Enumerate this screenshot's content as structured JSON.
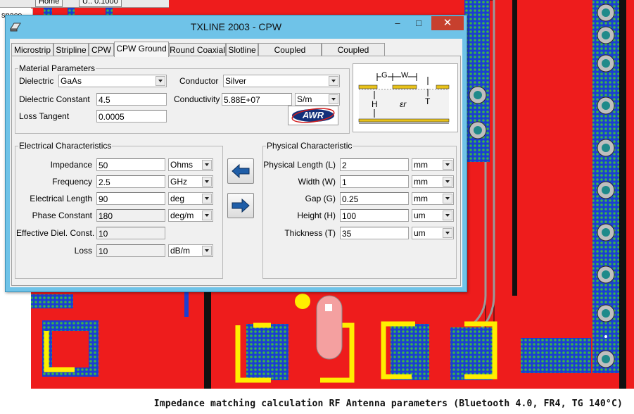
{
  "background": {
    "toolbar_buttons": [
      "Home",
      "U.. 0.1000"
    ],
    "left_label": "space",
    "caption": "Impedance matching calculation RF Antenna parameters (Bluetooth 4.0, FR4, TG 140°C)",
    "colors": {
      "board_red": "#ee1c1c",
      "via_teal": "#1f8a8a",
      "pad_yellow": "#ffee00",
      "trace_black": "#101010",
      "dot_green": "#2a9a4a"
    }
  },
  "window": {
    "title": "TXLINE 2003 - CPW",
    "controls": {
      "minimize": "–",
      "maximize": "□",
      "close": "✕"
    }
  },
  "tabs": [
    {
      "label": "Microstrip",
      "active": false
    },
    {
      "label": "Stripline",
      "active": false
    },
    {
      "label": "CPW",
      "active": false
    },
    {
      "label": "CPW Ground",
      "active": true
    },
    {
      "label": "Round Coaxial",
      "active": false
    },
    {
      "label": "Slotline",
      "active": false
    },
    {
      "label": "Coupled MSLine",
      "active": false
    },
    {
      "label": "Coupled Stripline",
      "active": false
    }
  ],
  "material": {
    "legend": "Material Parameters",
    "dielectric_label": "Dielectric",
    "dielectric_value": "GaAs",
    "conductor_label": "Conductor",
    "conductor_value": "Silver",
    "dielectric_constant_label": "Dielectric Constant",
    "dielectric_constant_value": "4.5",
    "conductivity_label": "Conductivity",
    "conductivity_value": "5.88E+07",
    "conductivity_unit": "S/m",
    "loss_tangent_label": "Loss Tangent",
    "loss_tangent_value": "0.0005",
    "awr_logo": "AWR"
  },
  "diagram": {
    "g_label": "G",
    "w_label": "W",
    "h_label": "H",
    "t_label": "T",
    "er_label": "εr"
  },
  "electrical": {
    "legend": "Electrical Characteristics",
    "rows": [
      {
        "label": "Impedance",
        "value": "50",
        "unit": "Ohms",
        "readonly": false
      },
      {
        "label": "Frequency",
        "value": "2.5",
        "unit": "GHz",
        "readonly": false
      },
      {
        "label": "Electrical Length",
        "value": "90",
        "unit": "deg",
        "readonly": false
      },
      {
        "label": "Phase Constant",
        "value": "180",
        "unit": "deg/m",
        "readonly": true
      },
      {
        "label": "Effective Diel. Const.",
        "value": "10",
        "unit": "",
        "readonly": true
      },
      {
        "label": "Loss",
        "value": "10",
        "unit": "dB/m",
        "readonly": true
      }
    ]
  },
  "physical": {
    "legend": "Physical Characteristic",
    "rows": [
      {
        "label": "Physical Length (L)",
        "value": "2",
        "unit": "mm"
      },
      {
        "label": "Width (W)",
        "value": "1",
        "unit": "mm"
      },
      {
        "label": "Gap (G)",
        "value": "0.25",
        "unit": "mm"
      },
      {
        "label": "Height (H)",
        "value": "100",
        "unit": "um"
      },
      {
        "label": "Thickness (T)",
        "value": "35",
        "unit": "um"
      }
    ]
  },
  "arrows": {
    "synthesize": "left-arrow-icon",
    "analyze": "right-arrow-icon",
    "color": "#1f5ea8"
  }
}
